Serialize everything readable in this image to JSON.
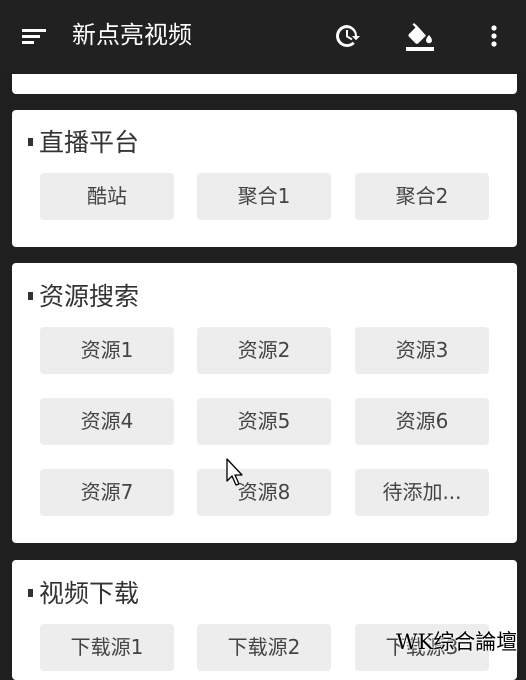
{
  "appbar": {
    "title": "新点亮视频",
    "icons": [
      "menu-icon",
      "history-icon",
      "paint-bucket-icon",
      "more-vert-icon"
    ]
  },
  "sections": {
    "live": {
      "title": "直播平台",
      "buttons": [
        "酷站",
        "聚合1",
        "聚合2"
      ]
    },
    "resources": {
      "title": "资源搜索",
      "buttons": [
        "资源1",
        "资源2",
        "资源3",
        "资源4",
        "资源5",
        "资源6",
        "资源7",
        "资源8",
        "待添加..."
      ]
    },
    "download": {
      "title": "视频下载",
      "buttons": [
        "下载源1",
        "下载源2",
        "下载源3"
      ]
    }
  },
  "watermark": "WK综合論壇",
  "colors": {
    "appbar": "#212121",
    "button": "#ededed",
    "card": "#ffffff"
  }
}
